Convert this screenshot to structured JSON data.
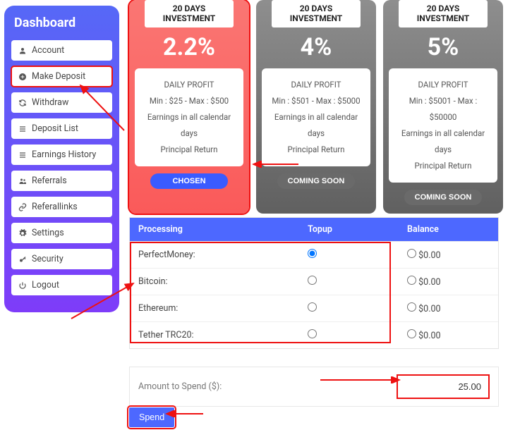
{
  "sidebar": {
    "title": "Dashboard",
    "items": [
      {
        "label": "Account"
      },
      {
        "label": "Make Deposit"
      },
      {
        "label": "Withdraw"
      },
      {
        "label": "Deposit List"
      },
      {
        "label": "Earnings History"
      },
      {
        "label": "Referrals"
      },
      {
        "label": "Referallinks"
      },
      {
        "label": "Settings"
      },
      {
        "label": "Security"
      },
      {
        "label": "Logout"
      }
    ]
  },
  "plans": [
    {
      "title": "20 DAYS INVESTMENT",
      "rate": "2.2%",
      "profit_label": "DAILY PROFIT",
      "range": "Min : $25 - Max : $500",
      "earnings": "Earnings in all calendar days",
      "principal": "Principal Return",
      "button": "CHOSEN"
    },
    {
      "title": "20 DAYS INVESTMENT",
      "rate": "4%",
      "profit_label": "DAILY PROFIT",
      "range": "Min : $501 - Max : $5000",
      "earnings": "Earnings in all calendar days",
      "principal": "Principal Return",
      "button": "COMING SOON"
    },
    {
      "title": "20 DAYS INVESTMENT",
      "rate": "5%",
      "profit_label": "DAILY PROFIT",
      "range": "Min : $5001 - Max : $50000",
      "earnings": "Earnings in all calendar days",
      "principal": "Principal Return",
      "button": "COMING SOON"
    }
  ],
  "table": {
    "headers": {
      "processing": "Processing",
      "topup": "Topup",
      "balance": "Balance"
    },
    "rows": [
      {
        "name": "PerfectMoney:",
        "checked": true,
        "balance": "$0.00"
      },
      {
        "name": "Bitcoin:",
        "checked": false,
        "balance": "$0.00"
      },
      {
        "name": "Ethereum:",
        "checked": false,
        "balance": "$0.00"
      },
      {
        "name": "Tether TRC20:",
        "checked": false,
        "balance": "$0.00"
      }
    ]
  },
  "amount": {
    "label": "Amount to Spend ($):",
    "value": "25.00"
  },
  "spend_label": "Spend"
}
